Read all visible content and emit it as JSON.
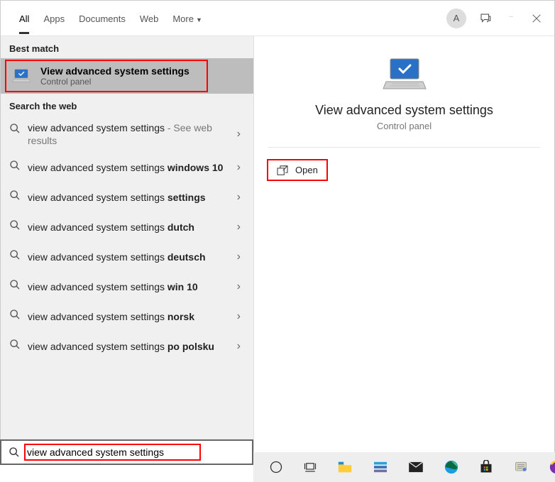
{
  "header": {
    "tabs": [
      {
        "label": "All",
        "active": true
      },
      {
        "label": "Apps",
        "active": false
      },
      {
        "label": "Documents",
        "active": false
      },
      {
        "label": "Web",
        "active": false
      },
      {
        "label": "More",
        "active": false,
        "caret": true
      }
    ],
    "avatar_letter": "A"
  },
  "left": {
    "best_match_header": "Best match",
    "best": {
      "title": "View advanced system settings",
      "subtitle": "Control panel"
    },
    "web_header": "Search the web",
    "items": [
      {
        "plain": "view advanced system settings",
        "bold": "",
        "suffix": " - See web results"
      },
      {
        "plain": "view advanced system settings ",
        "bold": "windows 10",
        "suffix": ""
      },
      {
        "plain": "view advanced system settings ",
        "bold": "settings",
        "suffix": ""
      },
      {
        "plain": "view advanced system settings ",
        "bold": "dutch",
        "suffix": ""
      },
      {
        "plain": "view advanced system settings ",
        "bold": "deutsch",
        "suffix": ""
      },
      {
        "plain": "view advanced system settings ",
        "bold": "win 10",
        "suffix": ""
      },
      {
        "plain": "view advanced system settings ",
        "bold": "norsk",
        "suffix": ""
      },
      {
        "plain": "view advanced system settings ",
        "bold": "po polsku",
        "suffix": ""
      }
    ]
  },
  "right": {
    "title": "View advanced system settings",
    "subtitle": "Control panel",
    "open_label": "Open"
  },
  "search": {
    "value": "view advanced system settings"
  }
}
